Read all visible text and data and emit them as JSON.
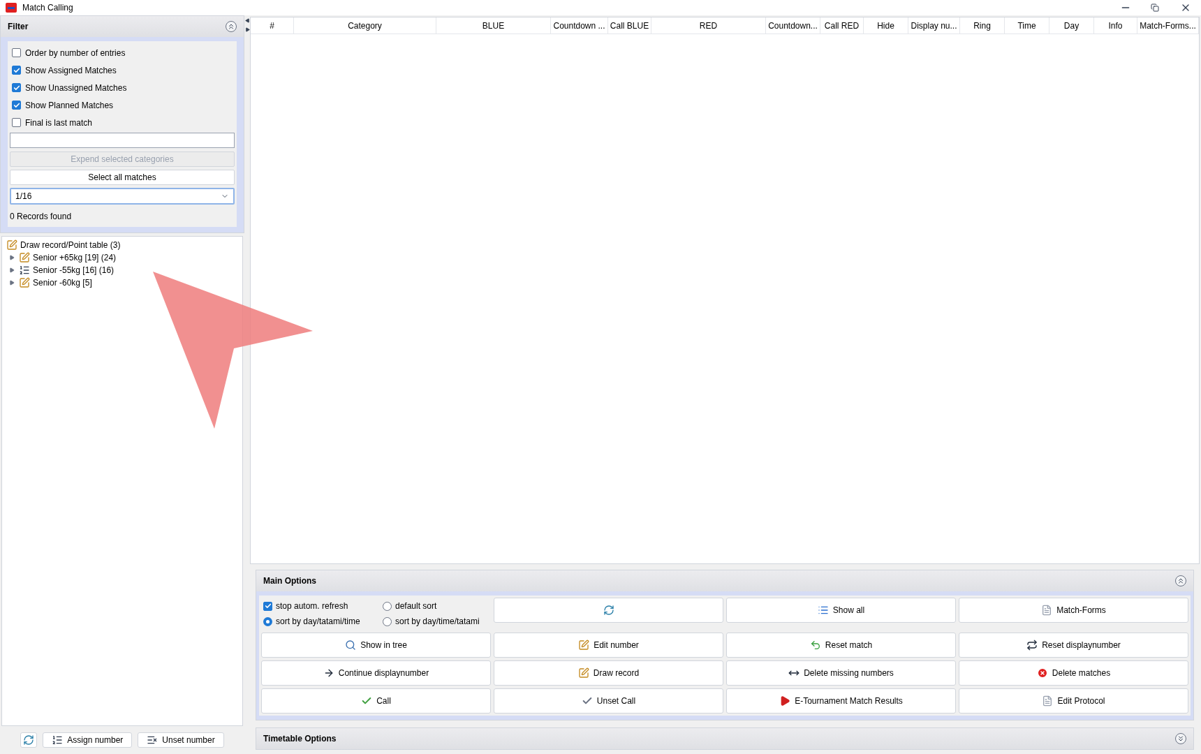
{
  "window": {
    "title": "Match Calling"
  },
  "filter": {
    "title": "Filter",
    "expanded": true,
    "checkboxes": [
      {
        "label": "Order by number of entries",
        "checked": false
      },
      {
        "label": "Show Assigned Matches",
        "checked": true
      },
      {
        "label": "Show Unassigned Matches",
        "checked": true
      },
      {
        "label": "Show Planned Matches",
        "checked": true
      },
      {
        "label": "Final is last match",
        "checked": false
      }
    ],
    "buttons": [
      {
        "label": "Expend selected categories",
        "disabled": true
      },
      {
        "label": "Select all matches",
        "disabled": false
      }
    ],
    "round_dropdown": {
      "value": "1/16"
    },
    "records": "0 Records found"
  },
  "tree": {
    "items": [
      {
        "label": "Draw record/Point table (3)",
        "kind": "record",
        "children": [
          {
            "label": "Senior +65kg [19] (24)",
            "kind": "record",
            "expanded": false
          },
          {
            "label": "Senior -55kg [16] (16)",
            "kind": "list",
            "expanded": false
          },
          {
            "label": "Senior -60kg [5]",
            "kind": "record",
            "expanded": false
          }
        ]
      }
    ]
  },
  "bottom_bar": {
    "buttons": [
      {
        "kind": "refresh"
      },
      {
        "label": "Assign number",
        "kind": "assign"
      },
      {
        "label": "Unset number",
        "kind": "unset"
      }
    ]
  },
  "table": {
    "columns": [
      "#",
      "Category",
      "BLUE",
      "Countdown ...",
      "Call BLUE",
      "RED",
      "Countdown...",
      "Call RED",
      "Hide",
      "Display nu...",
      "Ring",
      "Time",
      "Day",
      "Info",
      "Match-Forms..."
    ]
  },
  "main_options": {
    "title": "Main Options",
    "expanded": true,
    "checkbox": {
      "label": "stop autom. refresh",
      "checked": true
    },
    "radios": [
      {
        "label": "default sort",
        "selected": false
      },
      {
        "label": "sort by day/tatami/time",
        "selected": true
      },
      {
        "label": "sort by day/time/tatami",
        "selected": false
      }
    ],
    "buttons": [
      {
        "kind": "refresh"
      },
      {
        "label": "Show all",
        "kind": "list"
      },
      {
        "label": "Match-Forms",
        "kind": "document"
      },
      {
        "label": "Show in tree",
        "kind": "search"
      },
      {
        "label": "Edit number",
        "kind": "edit"
      },
      {
        "label": "Reset match",
        "kind": "undo"
      },
      {
        "label": "Reset displaynumber",
        "kind": "arrows"
      },
      {
        "label": "Continue displaynumber",
        "kind": "arrow"
      },
      {
        "label": "Draw record",
        "kind": "edit"
      },
      {
        "label": "Delete missing numbers",
        "kind": "move"
      },
      {
        "label": "Delete matches",
        "kind": "delete"
      },
      {
        "label": "Call",
        "kind": "check"
      },
      {
        "label": "Unset Call",
        "kind": "check-grey"
      },
      {
        "label": "E-Tournament Match Results",
        "kind": "etournament"
      },
      {
        "label": "Edit Protocol",
        "kind": "document"
      }
    ]
  },
  "timetable_options": {
    "title": "Timetable Options",
    "expanded": false
  }
}
